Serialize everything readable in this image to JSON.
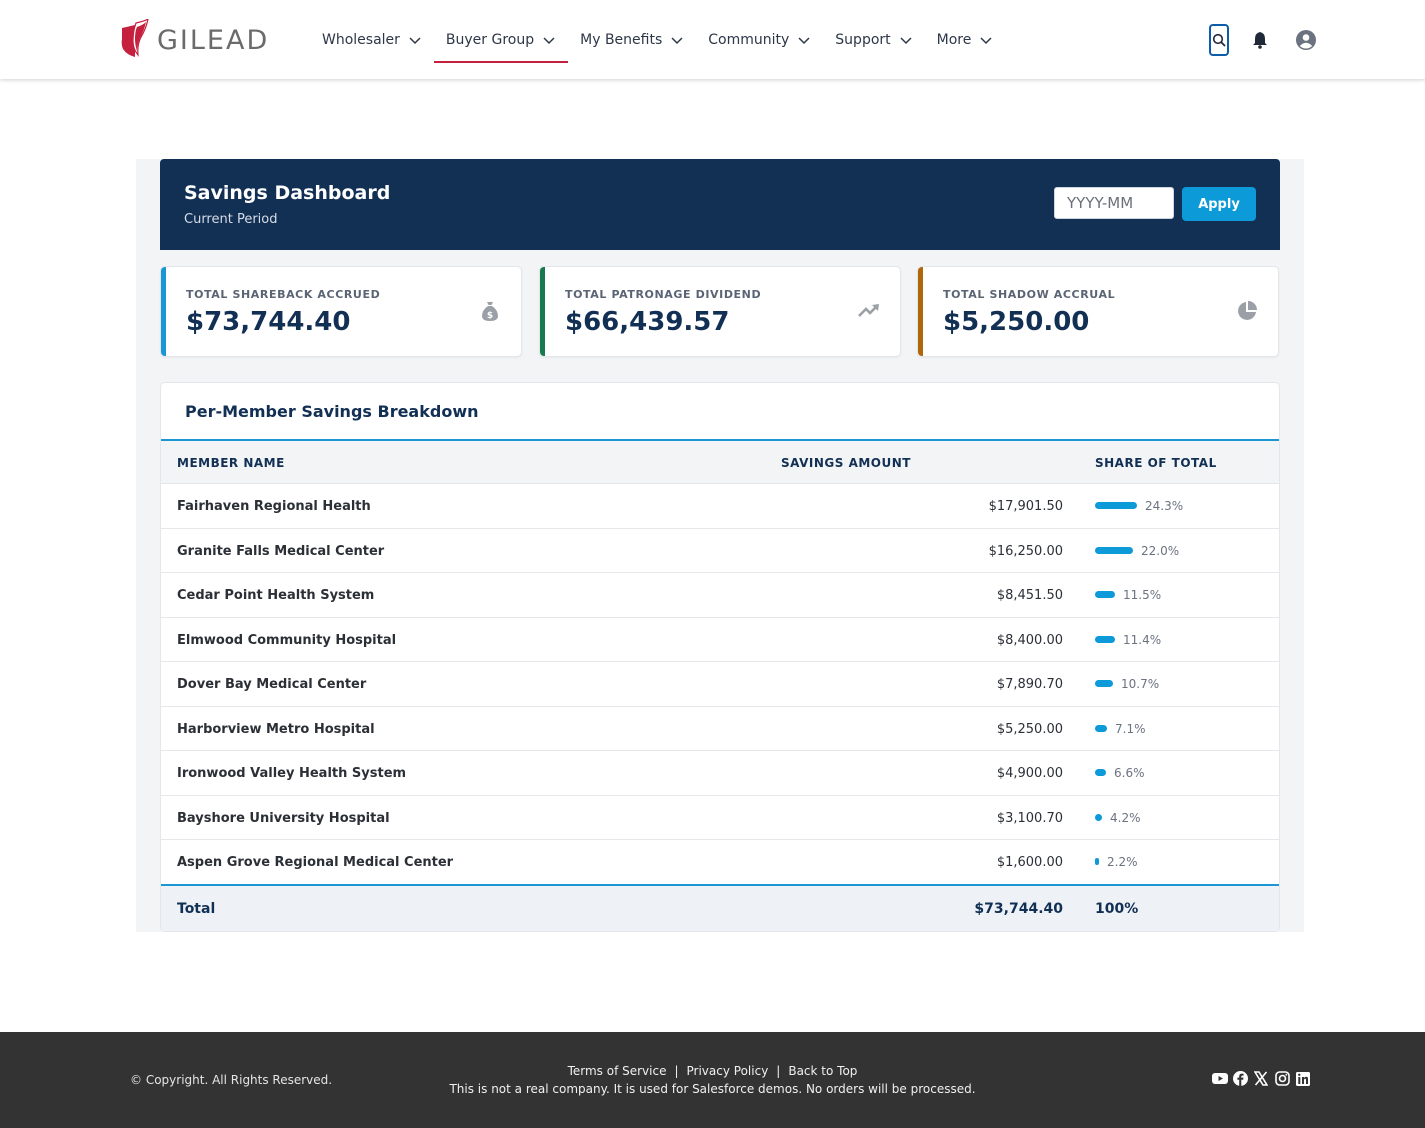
{
  "brand": {
    "name": "GILEAD",
    "color": "#c5203e"
  },
  "nav": [
    {
      "label": "Wholesaler"
    },
    {
      "label": "Buyer Group"
    },
    {
      "label": "My Benefits"
    },
    {
      "label": "Community"
    },
    {
      "label": "Support"
    },
    {
      "label": "More"
    }
  ],
  "active_nav": "Buyer Group",
  "header_icons": [
    "search-icon",
    "bell-icon",
    "user-avatar-icon"
  ],
  "dashboard": {
    "title": "Savings Dashboard",
    "subtitle": "Current Period",
    "period_placeholder": "YYYY-MM",
    "apply_label": "Apply"
  },
  "kpis": [
    {
      "label": "TOTAL SHAREBACK ACCRUED",
      "value": "$73,744.40",
      "accent": "#1b96d4",
      "icon": "money-bag-icon"
    },
    {
      "label": "TOTAL PATRONAGE DIVIDEND",
      "value": "$66,439.57",
      "accent": "#167a4e",
      "icon": "trend-up-icon"
    },
    {
      "label": "TOTAL SHADOW ACCRUAL",
      "value": "$5,250.00",
      "accent": "#b0660a",
      "icon": "pie-chart-icon"
    }
  ],
  "breakdown": {
    "title": "Per-Member Savings Breakdown",
    "columns": [
      "MEMBER NAME",
      "SAVINGS AMOUNT",
      "SHARE OF TOTAL"
    ],
    "rows": [
      {
        "name": "Fairhaven Regional Health",
        "amount": "$17,901.50",
        "share": "24.3%",
        "share_value": 24.3
      },
      {
        "name": "Granite Falls Medical Center",
        "amount": "$16,250.00",
        "share": "22.0%",
        "share_value": 22.0
      },
      {
        "name": "Cedar Point Health System",
        "amount": "$8,451.50",
        "share": "11.5%",
        "share_value": 11.5
      },
      {
        "name": "Elmwood Community Hospital",
        "amount": "$8,400.00",
        "share": "11.4%",
        "share_value": 11.4
      },
      {
        "name": "Dover Bay Medical Center",
        "amount": "$7,890.70",
        "share": "10.7%",
        "share_value": 10.7
      },
      {
        "name": "Harborview Metro Hospital",
        "amount": "$5,250.00",
        "share": "7.1%",
        "share_value": 7.1
      },
      {
        "name": "Ironwood Valley Health System",
        "amount": "$4,900.00",
        "share": "6.6%",
        "share_value": 6.6
      },
      {
        "name": "Bayshore University Hospital",
        "amount": "$3,100.70",
        "share": "4.2%",
        "share_value": 4.2
      },
      {
        "name": "Aspen Grove Regional Medical Center",
        "amount": "$1,600.00",
        "share": "2.2%",
        "share_value": 2.2
      }
    ],
    "total_label": "Total",
    "total_amount": "$73,744.40",
    "total_share": "100%"
  },
  "footer": {
    "copyright": "© Copyright. All Rights Reserved.",
    "links": [
      "Terms of Service",
      "Privacy Policy",
      "Back to Top"
    ],
    "note": "This is not a real company. It is used for Salesforce demos. No orders will be processed.",
    "social": [
      "youtube-icon",
      "facebook-icon",
      "x-icon",
      "instagram-icon",
      "linkedin-icon"
    ]
  }
}
